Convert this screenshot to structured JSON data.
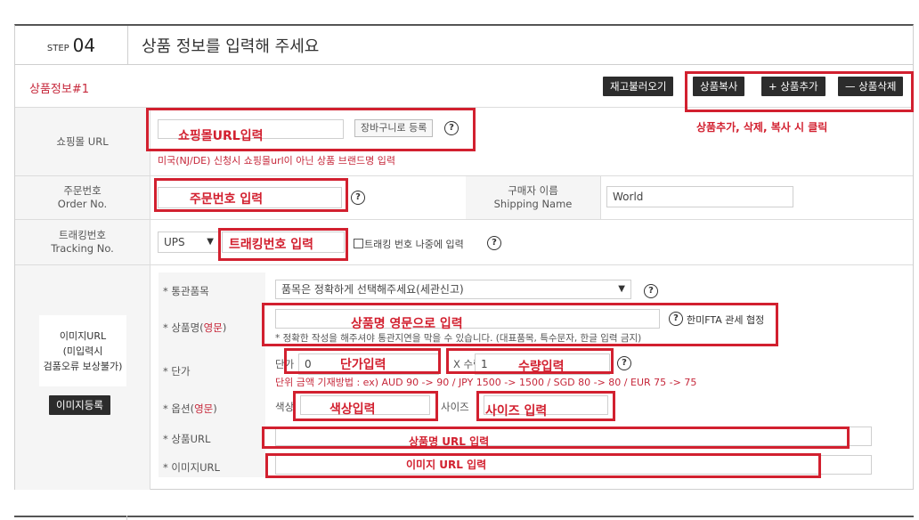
{
  "step": {
    "small": "STEP",
    "number": "04",
    "title": "상품 정보를 입력해 주세요"
  },
  "product_header": {
    "title": "상품정보#1",
    "reload_btn": "재고불러오기",
    "copy_btn": "상품복사",
    "add_btn": "+ 상품추가",
    "delete_btn": "— 상품삭제",
    "annotation": "상품추가, 삭제, 복사 시 클릭"
  },
  "shop_url": {
    "label": "쇼핑몰 URL",
    "annotation": "쇼핑몰URL입력",
    "cart_btn": "장바구니로 등록",
    "note": "미국(NJ/DE) 신청시 쇼핑몰url이 아닌 상품 브랜드명 입력"
  },
  "order_no": {
    "label_ko": "주문번호",
    "label_en": "Order No.",
    "annotation": "주문번호 입력",
    "buyer_label_ko": "구매자 이름",
    "buyer_label_en": "Shipping Name",
    "buyer_value": "World"
  },
  "tracking": {
    "label_ko": "트래킹번호",
    "label_en": "Tracking No.",
    "carrier": "UPS",
    "annotation": "트래킹번호 입력",
    "later_label": "트래킹 번호 나중에 입력"
  },
  "image_panel": {
    "label": "이미지URL",
    "note1": "(미입력시",
    "note2": "검품오류 보상불가)",
    "register_btn": "이미지등록"
  },
  "details": {
    "customs_label": "* 통관품목",
    "customs_value": "품목은 정확하게 선택해주세요(세관신고)",
    "name_label_prefix": "* 상품명(",
    "name_label_red": "영문",
    "name_label_suffix": ")",
    "name_annotation": "상품명 영문으로 입력",
    "fta_label": "한미FTA 관세 협정",
    "name_note": "* 정확한 작성을 해주셔야 통관지연을 막을 수 있습니다. (대표품목, 특수문자, 한글 입력 금지)",
    "price_label": "* 단가",
    "price_prefix": "단가",
    "price_value": "0",
    "price_annotation": "단가입력",
    "qty_x": "X 수량",
    "qty_value": "1",
    "qty_annotation": "수량입력",
    "price_note": "단위 금액 기재방법 : ex) AUD 90 -> 90 / JPY 1500 -> 1500 / SGD 80 -> 80 / EUR 75 -> 75",
    "option_label_prefix": "* 옵션(",
    "option_label_red": "영문",
    "option_label_suffix": ")",
    "color_prefix": "색상",
    "color_annotation": "색상입력",
    "size_prefix": "사이즈",
    "size_annotation": "사이즈 입력",
    "product_url_label": "* 상품URL",
    "product_url_annotation": "상품명 URL 입력",
    "image_url_label": "* 이미지URL",
    "image_url_annotation": "이미지 URL 입력"
  },
  "colors": {
    "accent_red": "#d2202f",
    "label_red": "#c6273a",
    "dark_button": "#2c2c2c"
  }
}
